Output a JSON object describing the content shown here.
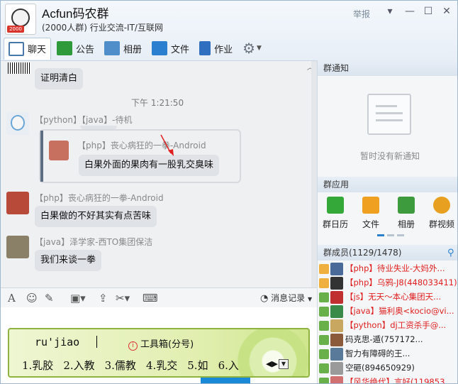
{
  "window": {
    "group_name": "Acfun码农群",
    "group_sub": "(2000人群) 行业交流-IT/互联网",
    "report_label": "举报",
    "avatar_badge": "2000"
  },
  "tabs": [
    {
      "label": "聊天",
      "icon": "chat-icon"
    },
    {
      "label": "公告",
      "icon": "flag-icon"
    },
    {
      "label": "相册",
      "icon": "photo-icon"
    },
    {
      "label": "文件",
      "icon": "folder-icon"
    },
    {
      "label": "作业",
      "icon": "homework-icon"
    }
  ],
  "chat": {
    "top_bubble": "证明清白",
    "timestamp": "下午 1:21:50",
    "messages": [
      {
        "sender": "【python】【java】-待机",
        "text": ""
      },
      {
        "quote_sender": "【php】丧心病狂的一拳-Android",
        "quote_text": "白果外面的果肉有一股乳交臭味"
      },
      {
        "sender": "【php】丧心病狂的一拳-Android",
        "text": "白果做的不好其实有点苦味"
      },
      {
        "sender": "【java】泽学家-西TO集团保洁",
        "text": "我们来谈一拳"
      }
    ]
  },
  "input_toolbar": {
    "history_label": "消息记录"
  },
  "right_panel": {
    "notice_title": "群通知",
    "notice_empty": "暂时没有新通知",
    "apps_title": "群应用",
    "apps": [
      {
        "label": "群日历",
        "color": "#35a83a"
      },
      {
        "label": "文件",
        "color": "#f0a020"
      },
      {
        "label": "相册",
        "color": "#3d9a3d"
      },
      {
        "label": "群视频",
        "color": "#e8a020"
      }
    ],
    "members_title": "群成员(1129/1478)",
    "members": [
      {
        "text": "【php】待业失业-大妈外...",
        "color": "red"
      },
      {
        "text": "【php】乌鸦-J8(448033411)",
        "color": "red"
      },
      {
        "text": "【js】无天～本心集团天...",
        "color": "red"
      },
      {
        "text": "【java】猫利奥<kocio@vi...",
        "color": "red"
      },
      {
        "text": "【python】dj工资杀手@...",
        "color": "red"
      },
      {
        "text": "码克思-遁(757172...",
        "color": "blk"
      },
      {
        "text": "智力有障碍的王...",
        "color": "blk"
      },
      {
        "text": "空砸(894650929)",
        "color": "blk"
      },
      {
        "text": "【风华绝代】言好(119853...",
        "color": "red"
      }
    ]
  },
  "ime": {
    "composition": "ru'jiao",
    "toolbox_label": "工具箱(分号)",
    "candidates": [
      "1.乳胶",
      "2.入教",
      "3.儒教",
      "4.乳交",
      "5.如",
      "6.入"
    ]
  }
}
